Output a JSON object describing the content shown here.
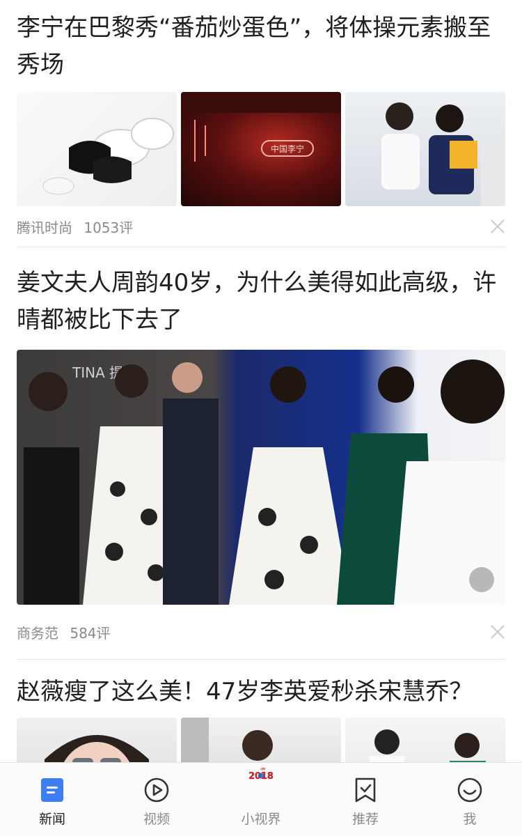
{
  "feed": {
    "articles": [
      {
        "title": "李宁在巴黎秀“番茄炒蛋色”，将体操元素搬至秀场",
        "source": "腾讯时尚",
        "comments": "1053评"
      },
      {
        "title": "姜文夫人周韵40岁，为什么美得如此高级，许晴都被比下去了",
        "source": "商务范",
        "comments": "584评",
        "image_text": "TINA 提娜"
      },
      {
        "title": "赵薇瘦了这么美！47岁李英爱秒杀宋慧乔？"
      }
    ],
    "neon_sign_text": "中国李宁"
  },
  "tabbar": {
    "tabs": [
      {
        "label": "新闻",
        "icon": "news-icon",
        "active": true
      },
      {
        "label": "视频",
        "icon": "video-play-icon",
        "active": false
      },
      {
        "label": "小视界",
        "icon": "world-cup-2018-logo",
        "active": false
      },
      {
        "label": "推荐",
        "icon": "bookmark-check-icon",
        "active": false
      },
      {
        "label": "我",
        "icon": "smiley-icon",
        "active": false
      }
    ],
    "logo_text": {
      "top": "RUSSIA",
      "year": "2018"
    }
  },
  "colors": {
    "accent": "#3d7ef4",
    "logo_red": "#d8232a",
    "logo_blue": "#1c5fb3"
  }
}
